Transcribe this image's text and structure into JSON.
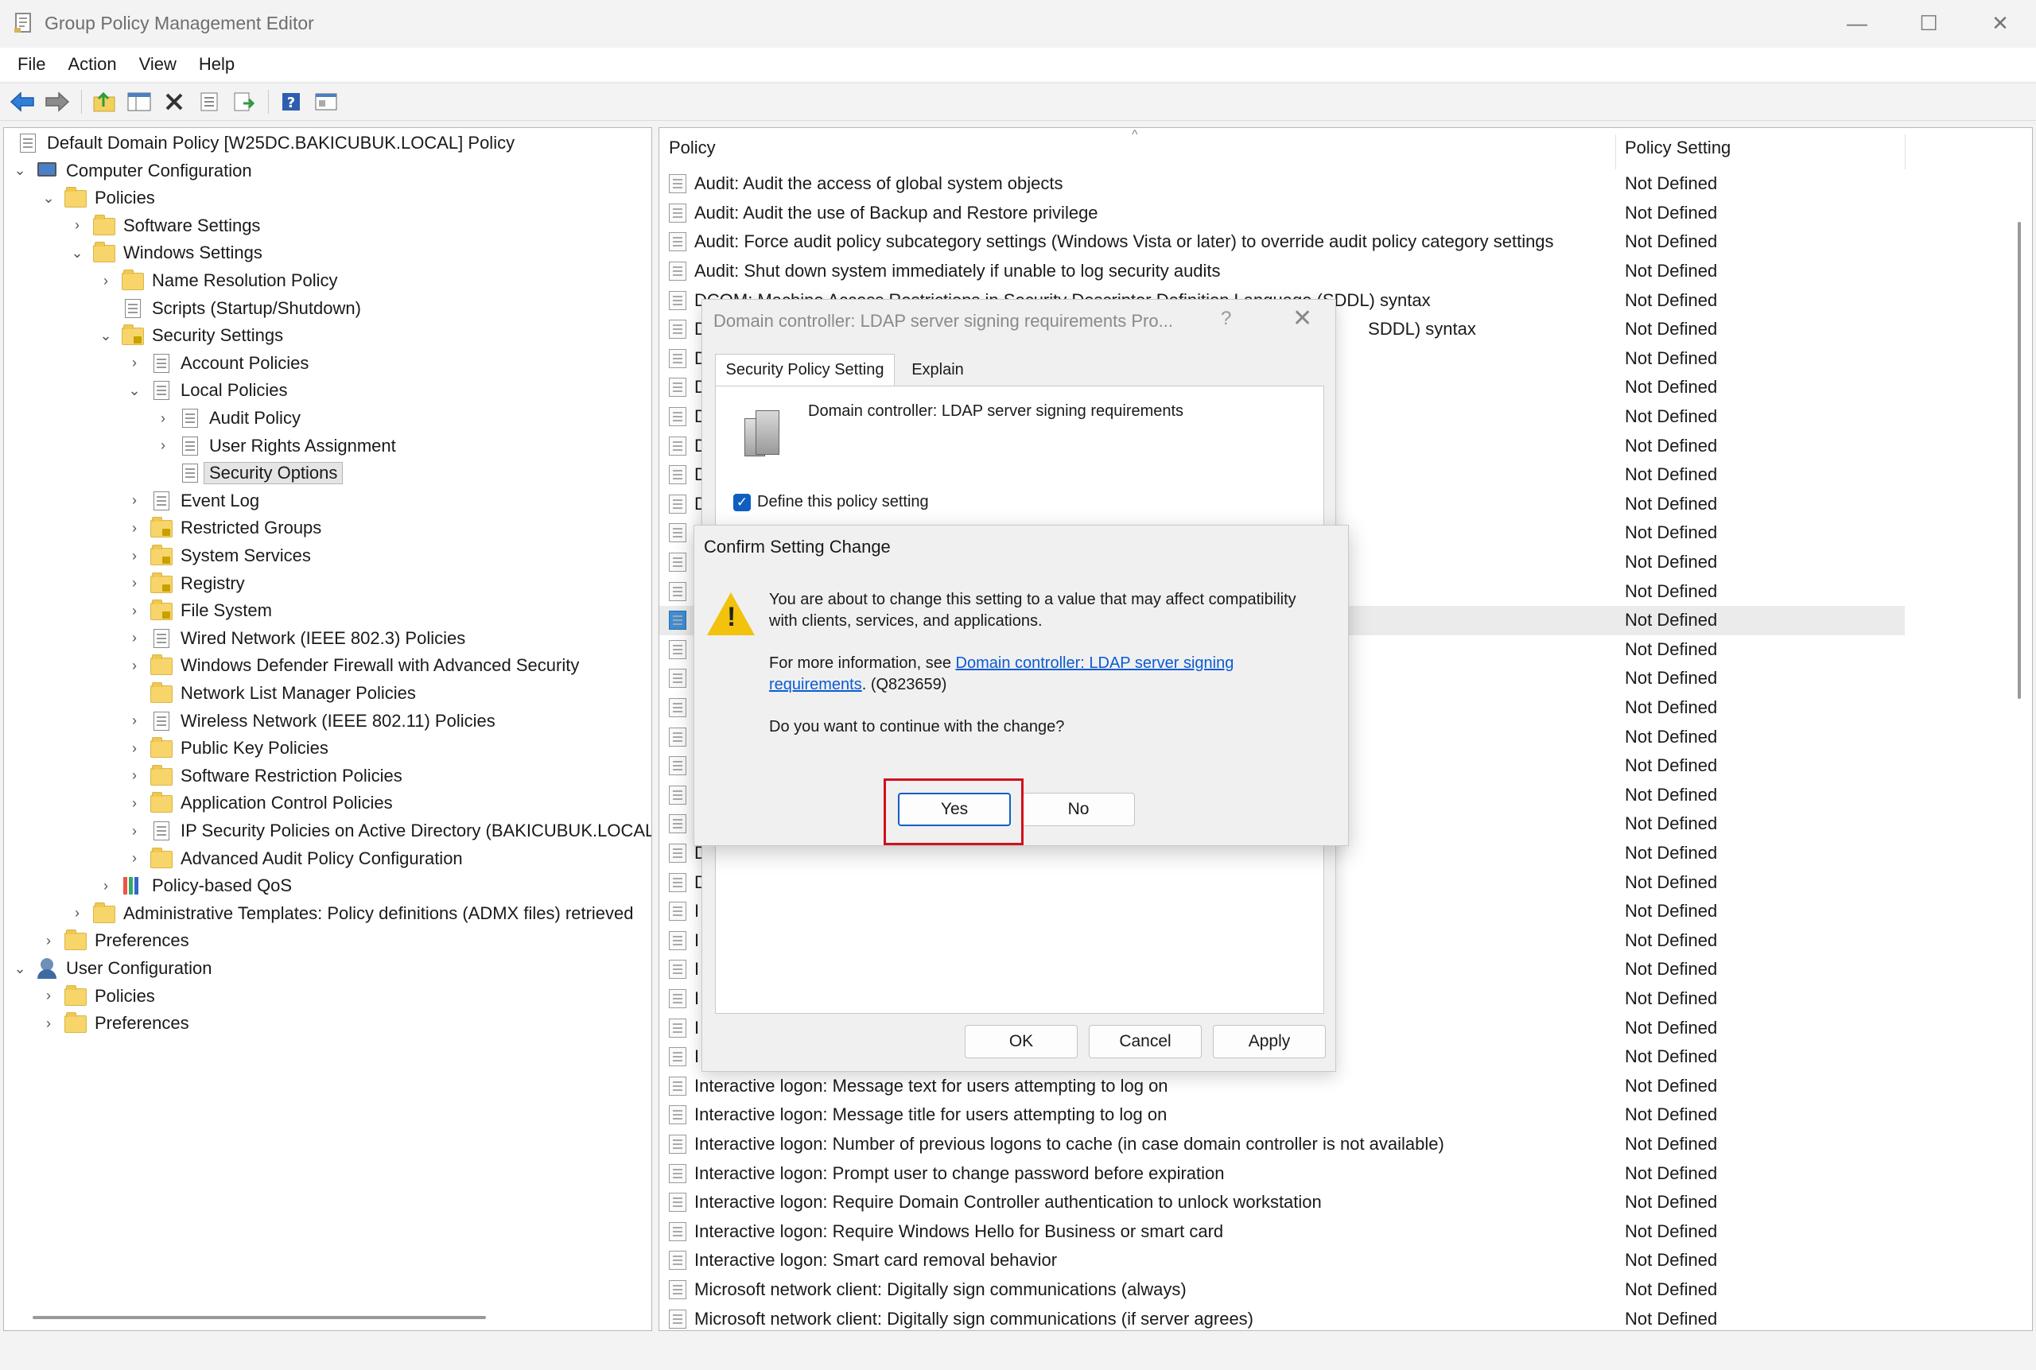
{
  "window": {
    "title": "Group Policy Management Editor",
    "minimize": "—",
    "maximize": "☐",
    "close": "✕"
  },
  "menu": [
    "File",
    "Action",
    "View",
    "Help"
  ],
  "tree": [
    {
      "label": "Default Domain Policy [W25DC.BAKICUBUK.LOCAL] Policy",
      "level": 0,
      "chevron": "",
      "icon": "doc"
    },
    {
      "label": "Computer Configuration",
      "level": 0,
      "chevron": "v",
      "icon": "pc"
    },
    {
      "label": "Policies",
      "level": 1,
      "chevron": "v",
      "icon": "folder"
    },
    {
      "label": "Software Settings",
      "level": 2,
      "chevron": ">",
      "icon": "folder"
    },
    {
      "label": "Windows Settings",
      "level": 2,
      "chevron": "v",
      "icon": "folder"
    },
    {
      "label": "Name Resolution Policy",
      "level": 3,
      "chevron": ">",
      "icon": "folder"
    },
    {
      "label": "Scripts (Startup/Shutdown)",
      "level": 3,
      "chevron": "",
      "icon": "doc"
    },
    {
      "label": "Security Settings",
      "level": 3,
      "chevron": "v",
      "icon": "secfolder"
    },
    {
      "label": "Account Policies",
      "level": 4,
      "chevron": ">",
      "icon": "doc"
    },
    {
      "label": "Local Policies",
      "level": 4,
      "chevron": "v",
      "icon": "doc"
    },
    {
      "label": "Audit Policy",
      "level": 5,
      "chevron": ">",
      "icon": "doc"
    },
    {
      "label": "User Rights Assignment",
      "level": 5,
      "chevron": ">",
      "icon": "doc"
    },
    {
      "label": "Security Options",
      "level": 5,
      "chevron": "",
      "icon": "doc",
      "selected": true
    },
    {
      "label": "Event Log",
      "level": 4,
      "chevron": ">",
      "icon": "doc"
    },
    {
      "label": "Restricted Groups",
      "level": 4,
      "chevron": ">",
      "icon": "secfolder"
    },
    {
      "label": "System Services",
      "level": 4,
      "chevron": ">",
      "icon": "secfolder"
    },
    {
      "label": "Registry",
      "level": 4,
      "chevron": ">",
      "icon": "secfolder"
    },
    {
      "label": "File System",
      "level": 4,
      "chevron": ">",
      "icon": "secfolder"
    },
    {
      "label": "Wired Network (IEEE 802.3) Policies",
      "level": 4,
      "chevron": ">",
      "icon": "doc"
    },
    {
      "label": "Windows Defender Firewall with Advanced Security",
      "level": 4,
      "chevron": ">",
      "icon": "folder"
    },
    {
      "label": "Network List Manager Policies",
      "level": 4,
      "chevron": "",
      "icon": "folder"
    },
    {
      "label": "Wireless Network (IEEE 802.11) Policies",
      "level": 4,
      "chevron": ">",
      "icon": "doc"
    },
    {
      "label": "Public Key Policies",
      "level": 4,
      "chevron": ">",
      "icon": "folder"
    },
    {
      "label": "Software Restriction Policies",
      "level": 4,
      "chevron": ">",
      "icon": "folder"
    },
    {
      "label": "Application Control Policies",
      "level": 4,
      "chevron": ">",
      "icon": "folder"
    },
    {
      "label": "IP Security Policies on Active Directory (BAKICUBUK.LOCAL)",
      "level": 4,
      "chevron": ">",
      "icon": "doc"
    },
    {
      "label": "Advanced Audit Policy Configuration",
      "level": 4,
      "chevron": ">",
      "icon": "folder"
    },
    {
      "label": "Policy-based QoS",
      "level": 3,
      "chevron": ">",
      "icon": "chart"
    },
    {
      "label": "Administrative Templates: Policy definitions (ADMX files) retrieved",
      "level": 2,
      "chevron": ">",
      "icon": "folder"
    },
    {
      "label": "Preferences",
      "level": 1,
      "chevron": ">",
      "icon": "folder"
    },
    {
      "label": "User Configuration",
      "level": 0,
      "chevron": "v",
      "icon": "user"
    },
    {
      "label": "Policies",
      "level": 1,
      "chevron": ">",
      "icon": "folder"
    },
    {
      "label": "Preferences",
      "level": 1,
      "chevron": ">",
      "icon": "folder"
    }
  ],
  "list": {
    "col_policy": "Policy",
    "col_setting": "Policy Setting",
    "rows": [
      {
        "name": "Audit: Audit the access of global system objects",
        "value": "Not Defined"
      },
      {
        "name": "Audit: Audit the use of Backup and Restore privilege",
        "value": "Not Defined"
      },
      {
        "name": "Audit: Force audit policy subcategory settings (Windows Vista or later) to override audit policy category settings",
        "value": "Not Defined"
      },
      {
        "name": "Audit: Shut down system immediately if unable to log security audits",
        "value": "Not Defined"
      },
      {
        "name": "DCOM: Machine Access Restrictions in Security Descriptor Definition Language (SDDL) syntax",
        "value": "Not Defined"
      },
      {
        "name": "D                                                                                                                                        SDDL) syntax",
        "value": "Not Defined"
      },
      {
        "name": "D",
        "value": "Not Defined"
      },
      {
        "name": "D",
        "value": "Not Defined"
      },
      {
        "name": "D",
        "value": "Not Defined"
      },
      {
        "name": "D",
        "value": "Not Defined"
      },
      {
        "name": "D",
        "value": "Not Defined"
      },
      {
        "name": "D",
        "value": "Not Defined"
      },
      {
        "name": "",
        "value": "Not Defined"
      },
      {
        "name": "",
        "value": "Not Defined"
      },
      {
        "name": "",
        "value": "Not Defined"
      },
      {
        "name": "",
        "value": "Not Defined",
        "highlight": true
      },
      {
        "name": "",
        "value": "Not Defined"
      },
      {
        "name": "",
        "value": "Not Defined"
      },
      {
        "name": "",
        "value": "Not Defined"
      },
      {
        "name": "",
        "value": "Not Defined"
      },
      {
        "name": "",
        "value": "Not Defined"
      },
      {
        "name": "",
        "value": "Not Defined"
      },
      {
        "name": "",
        "value": "Not Defined"
      },
      {
        "name": "D",
        "value": "Not Defined"
      },
      {
        "name": "D",
        "value": "Not Defined"
      },
      {
        "name": "I",
        "value": "Not Defined"
      },
      {
        "name": "I",
        "value": "Not Defined"
      },
      {
        "name": "I",
        "value": "Not Defined"
      },
      {
        "name": "I",
        "value": "Not Defined"
      },
      {
        "name": "I",
        "value": "Not Defined"
      },
      {
        "name": "I",
        "value": "Not Defined"
      },
      {
        "name": "Interactive logon: Message text for users attempting to log on",
        "value": "Not Defined"
      },
      {
        "name": "Interactive logon: Message title for users attempting to log on",
        "value": "Not Defined"
      },
      {
        "name": "Interactive logon: Number of previous logons to cache (in case domain controller is not available)",
        "value": "Not Defined"
      },
      {
        "name": "Interactive logon: Prompt user to change password before expiration",
        "value": "Not Defined"
      },
      {
        "name": "Interactive logon: Require Domain Controller authentication to unlock workstation",
        "value": "Not Defined"
      },
      {
        "name": "Interactive logon: Require Windows Hello for Business or smart card",
        "value": "Not Defined"
      },
      {
        "name": "Interactive logon: Smart card removal behavior",
        "value": "Not Defined"
      },
      {
        "name": "Microsoft network client: Digitally sign communications (always)",
        "value": "Not Defined"
      },
      {
        "name": "Microsoft network client: Digitally sign communications (if server agrees)",
        "value": "Not Defined"
      }
    ]
  },
  "properties_dialog": {
    "title": "Domain controller: LDAP server signing requirements Pro...",
    "help": "?",
    "close": "✕",
    "tab_setting": "Security Policy Setting",
    "tab_explain": "Explain",
    "policy_name": "Domain controller: LDAP server signing requirements",
    "define_label": "Define this policy setting",
    "define_checked": true,
    "ok": "OK",
    "cancel": "Cancel",
    "apply": "Apply"
  },
  "confirm_dialog": {
    "title": "Confirm Setting Change",
    "line1": "You are about to change this setting to a value that may affect compatibility",
    "line2": "with clients, services, and applications.",
    "more_info_prefix": "For more information, see ",
    "link_part1": "Domain controller: LDAP server signing",
    "link_part2": "requirements",
    "kb": ". (Q823659)",
    "question": "Do you want to continue with the change?",
    "yes": "Yes",
    "no": "No"
  },
  "colors": {
    "accent": "#0f5fc1",
    "highlight_box": "#d0101b",
    "link": "#0b5bd3"
  }
}
